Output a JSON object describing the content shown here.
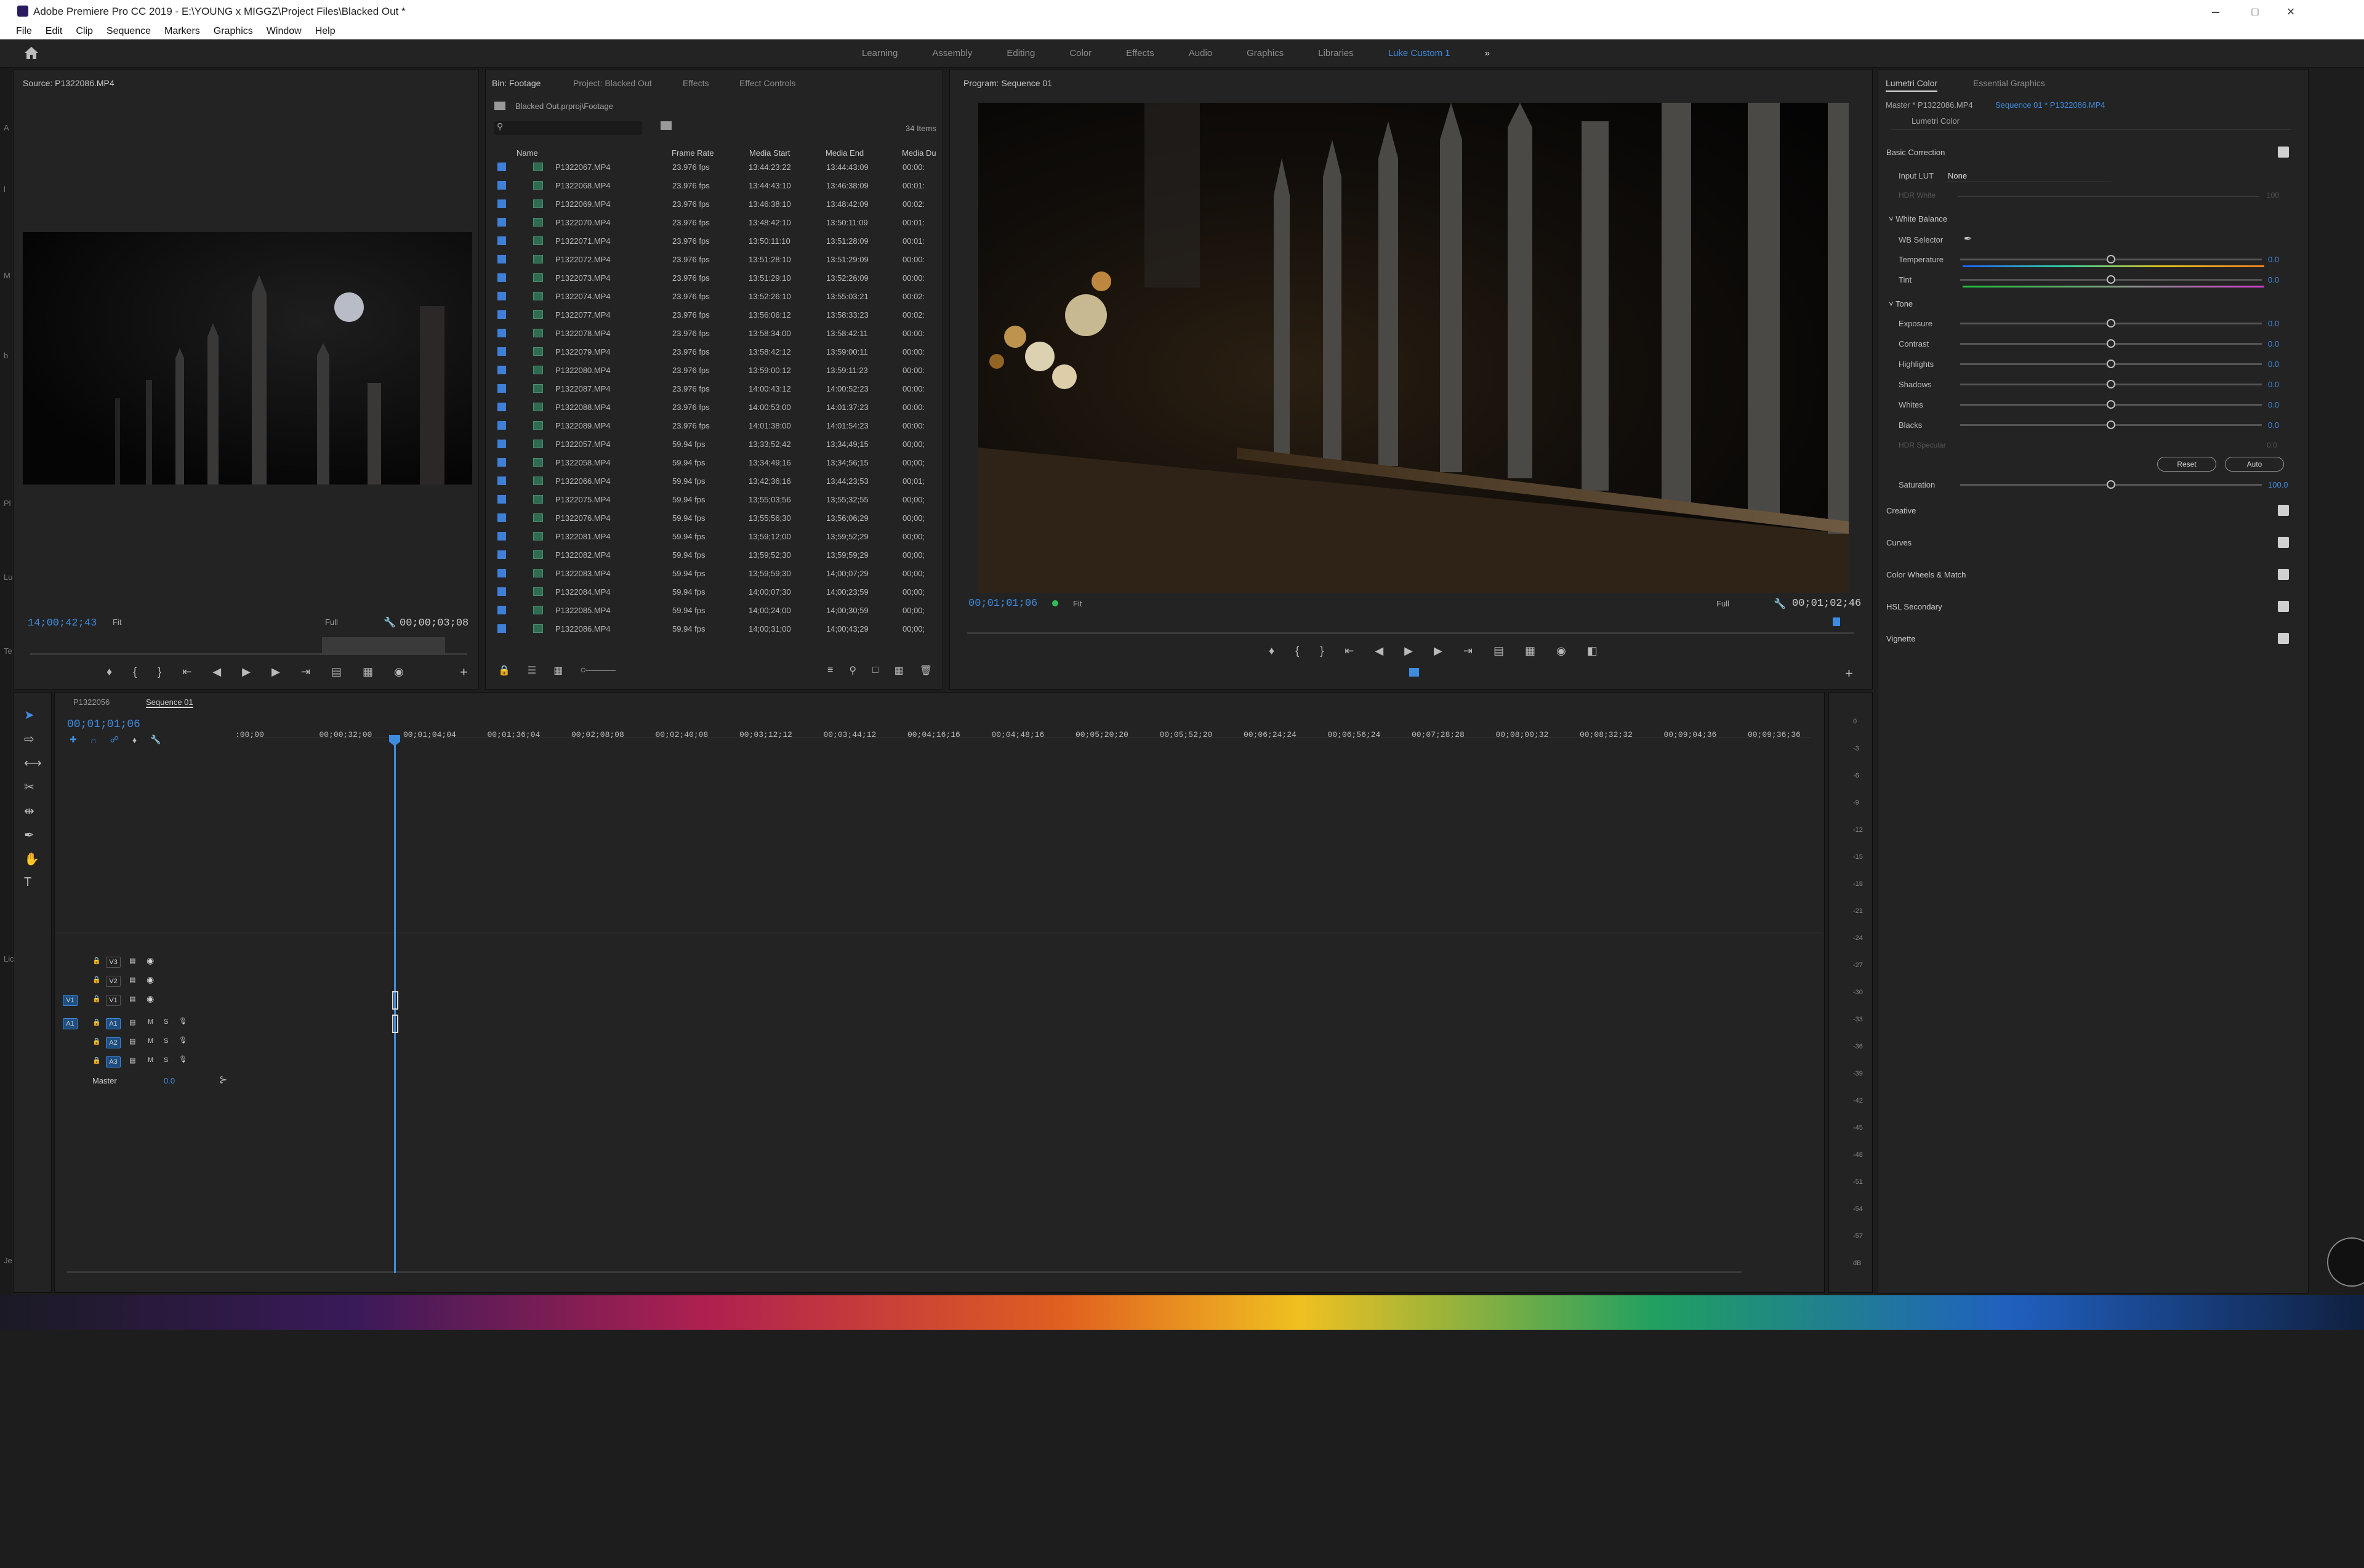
{
  "window": {
    "title": "Adobe Premiere Pro CC 2019 - E:\\YOUNG x MIGGZ\\Project Files\\Blacked Out *"
  },
  "menu": [
    "File",
    "Edit",
    "Clip",
    "Sequence",
    "Markers",
    "Graphics",
    "Window",
    "Help"
  ],
  "workspaces": {
    "items": [
      "Learning",
      "Assembly",
      "Editing",
      "Color",
      "Effects",
      "Audio",
      "Graphics",
      "Libraries"
    ],
    "active": "Luke Custom 1"
  },
  "source": {
    "title": "Source: P1322086.MP4",
    "timecode": "14;00;42;43",
    "fit": "Fit",
    "quality": "Full",
    "duration": "00;00;03;08"
  },
  "project": {
    "tabs": [
      "Bin: Footage",
      "Project: Blacked Out",
      "Effects",
      "Effect Controls"
    ],
    "path": "Blacked Out.prproj\\Footage",
    "items_count": "34 Items",
    "columns": [
      "Name",
      "Frame Rate",
      "Media Start",
      "Media End",
      "Media Du"
    ],
    "rows": [
      [
        "P1322067.MP4",
        "23.976 fps",
        "13:44:23:22",
        "13:44:43:09",
        "00:00:"
      ],
      [
        "P1322068.MP4",
        "23.976 fps",
        "13:44:43:10",
        "13:46:38:09",
        "00:01:"
      ],
      [
        "P1322069.MP4",
        "23.976 fps",
        "13:46:38:10",
        "13:48:42:09",
        "00:02:"
      ],
      [
        "P1322070.MP4",
        "23.976 fps",
        "13:48:42:10",
        "13:50:11:09",
        "00:01:"
      ],
      [
        "P1322071.MP4",
        "23.976 fps",
        "13:50:11:10",
        "13:51:28:09",
        "00:01:"
      ],
      [
        "P1322072.MP4",
        "23.976 fps",
        "13:51:28:10",
        "13:51:29:09",
        "00:00:"
      ],
      [
        "P1322073.MP4",
        "23.976 fps",
        "13:51:29:10",
        "13:52:26:09",
        "00:00:"
      ],
      [
        "P1322074.MP4",
        "23.976 fps",
        "13:52:26:10",
        "13:55:03:21",
        "00:02:"
      ],
      [
        "P1322077.MP4",
        "23.976 fps",
        "13:56:06:12",
        "13:58:33:23",
        "00:02:"
      ],
      [
        "P1322078.MP4",
        "23.976 fps",
        "13:58:34:00",
        "13:58:42:11",
        "00:00:"
      ],
      [
        "P1322079.MP4",
        "23.976 fps",
        "13:58:42:12",
        "13:59:00:11",
        "00:00:"
      ],
      [
        "P1322080.MP4",
        "23.976 fps",
        "13:59:00:12",
        "13:59:11:23",
        "00:00:"
      ],
      [
        "P1322087.MP4",
        "23.976 fps",
        "14:00:43:12",
        "14:00:52:23",
        "00:00:"
      ],
      [
        "P1322088.MP4",
        "23.976 fps",
        "14:00:53:00",
        "14:01:37:23",
        "00:00:"
      ],
      [
        "P1322089.MP4",
        "23.976 fps",
        "14:01:38:00",
        "14:01:54:23",
        "00:00:"
      ],
      [
        "P1322057.MP4",
        "59.94 fps",
        "13;33;52;42",
        "13;34;49;15",
        "00;00;"
      ],
      [
        "P1322058.MP4",
        "59.94 fps",
        "13;34;49;16",
        "13;34;56;15",
        "00;00;"
      ],
      [
        "P1322066.MP4",
        "59.94 fps",
        "13;42;36;16",
        "13;44;23;53",
        "00;01;"
      ],
      [
        "P1322075.MP4",
        "59.94 fps",
        "13;55;03;56",
        "13;55;32;55",
        "00;00;"
      ],
      [
        "P1322076.MP4",
        "59.94 fps",
        "13;55;56;30",
        "13;56;06;29",
        "00;00;"
      ],
      [
        "P1322081.MP4",
        "59.94 fps",
        "13;59;12;00",
        "13;59;52;29",
        "00;00;"
      ],
      [
        "P1322082.MP4",
        "59.94 fps",
        "13;59;52;30",
        "13;59;59;29",
        "00;00;"
      ],
      [
        "P1322083.MP4",
        "59.94 fps",
        "13;59;59;30",
        "14;00;07;29",
        "00;00;"
      ],
      [
        "P1322084.MP4",
        "59.94 fps",
        "14;00;07;30",
        "14;00;23;59",
        "00;00;"
      ],
      [
        "P1322085.MP4",
        "59.94 fps",
        "14;00;24;00",
        "14;00;30;59",
        "00;00;"
      ],
      [
        "P1322086.MP4",
        "59.94 fps",
        "14;00;31;00",
        "14;00;43;29",
        "00;00;"
      ]
    ]
  },
  "program": {
    "title": "Program: Sequence 01",
    "timecode": "00;01;01;06",
    "fit": "Fit",
    "quality": "Full",
    "duration": "00;01;02;46"
  },
  "lumetri": {
    "tabs": [
      "Lumetri Color",
      "Essential Graphics"
    ],
    "master": "Master * P1322086.MP4",
    "sequence": "Sequence 01 * P1322086.MP4",
    "effect": "Lumetri Color",
    "basic": "Basic Correction",
    "input_lut_label": "Input LUT",
    "input_lut_value": "None",
    "hdr_white": "HDR White",
    "hdr_white_value": "100",
    "white_balance": "White Balance",
    "wb_selector": "WB Selector",
    "sliders_wb": [
      {
        "label": "Temperature",
        "value": "0.0"
      },
      {
        "label": "Tint",
        "value": "0.0"
      }
    ],
    "tone": "Tone",
    "sliders_tone": [
      {
        "label": "Exposure",
        "value": "0.0"
      },
      {
        "label": "Contrast",
        "value": "0.0"
      },
      {
        "label": "Highlights",
        "value": "0.0"
      },
      {
        "label": "Shadows",
        "value": "0.0"
      },
      {
        "label": "Whites",
        "value": "0.0"
      },
      {
        "label": "Blacks",
        "value": "0.0"
      }
    ],
    "hdr_specular": "HDR Specular",
    "hdr_specular_value": "0.0",
    "reset": "Reset",
    "auto": "Auto",
    "saturation": {
      "label": "Saturation",
      "value": "100.0"
    },
    "sections": [
      "Creative",
      "Curves",
      "Color Wheels & Match",
      "HSL Secondary",
      "Vignette"
    ]
  },
  "timeline": {
    "tabs": [
      "P1322056",
      "Sequence 01"
    ],
    "timecode": "00;01;01;06",
    "ticks": [
      ":00;00",
      "00;00;32;00",
      "00;01;04;04",
      "00;01;36;04",
      "00;02;08;08",
      "00;02;40;08",
      "00;03;12;12",
      "00;03;44;12",
      "00;04;16;16",
      "00;04;48;16",
      "00;05;20;20",
      "00;05;52;20",
      "00;06;24;24",
      "00;06;56;24",
      "00;07;28;28",
      "00;08;00;32",
      "00;08;32;32",
      "00;09;04;36",
      "00;09;36;36"
    ],
    "video_tracks": [
      "V3",
      "V2",
      "V1"
    ],
    "audio_tracks": [
      "A1",
      "A2",
      "A3"
    ],
    "master_label": "Master",
    "master_value": "0.0",
    "meter_scale": [
      "0",
      "-3",
      "-6",
      "-9",
      "-12",
      "-15",
      "-18",
      "-21",
      "-24",
      "-27",
      "-30",
      "-33",
      "-36",
      "-39",
      "-42",
      "-45",
      "-48",
      "-51",
      "-54",
      "-57",
      "dB"
    ]
  },
  "left_edge_labels": [
    "A",
    "l",
    "M",
    "b",
    "Pl",
    "Lu",
    "Te",
    "Lic",
    "Je"
  ]
}
